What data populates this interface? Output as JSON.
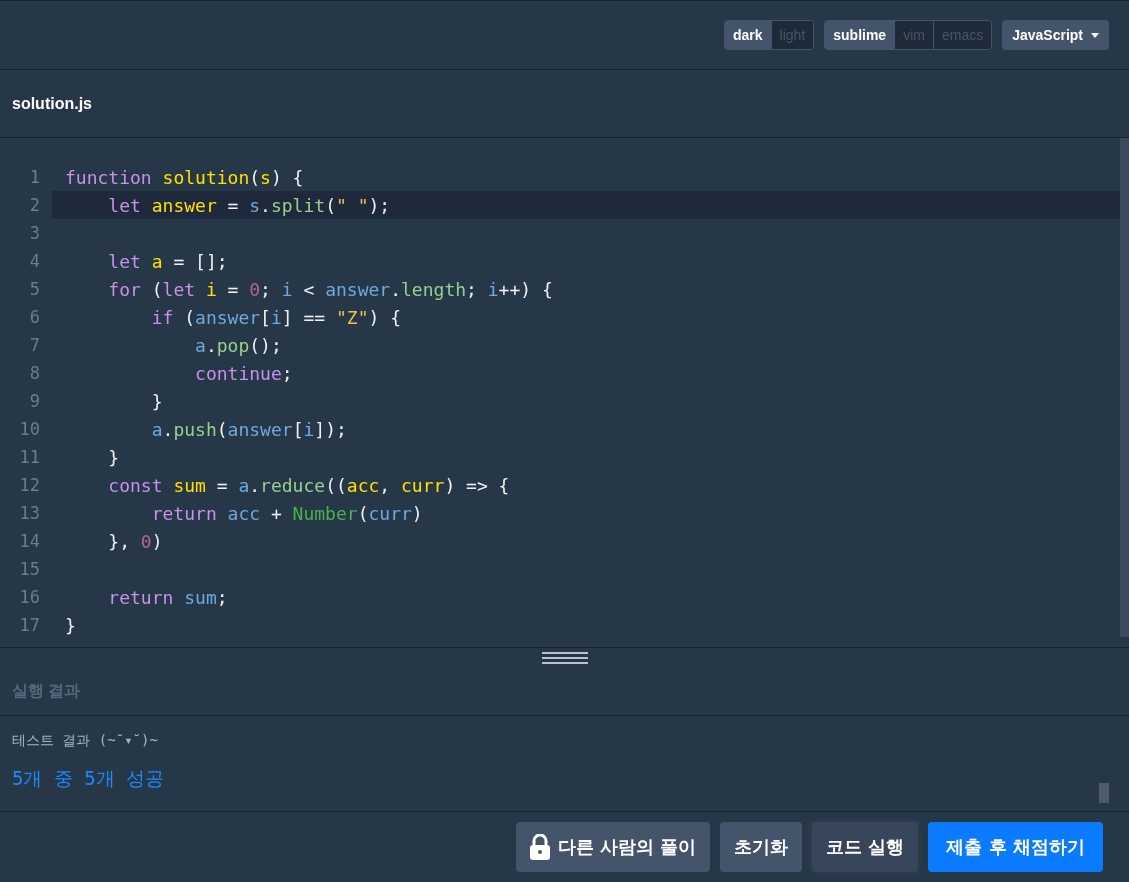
{
  "toolbar": {
    "theme_toggle": [
      {
        "label": "dark",
        "selected": true
      },
      {
        "label": "light",
        "selected": false
      }
    ],
    "keymap_toggle": [
      {
        "label": "sublime",
        "selected": true
      },
      {
        "label": "vim",
        "selected": false
      },
      {
        "label": "emacs",
        "selected": false
      }
    ],
    "language": "JavaScript"
  },
  "file_tab": "solution.js",
  "editor": {
    "lines": [
      {
        "number": "1",
        "active": false,
        "tokens": [
          {
            "text": "function ",
            "kind": "keyword"
          },
          {
            "text": "solution",
            "kind": "def"
          },
          {
            "text": "(",
            "kind": "plain"
          },
          {
            "text": "s",
            "kind": "def"
          },
          {
            "text": ") {",
            "kind": "plain"
          }
        ]
      },
      {
        "number": "2",
        "active": true,
        "tokens": [
          {
            "text": "    let ",
            "kind": "keyword"
          },
          {
            "text": "answer",
            "kind": "def"
          },
          {
            "text": " = ",
            "kind": "plain"
          },
          {
            "text": "s",
            "kind": "var"
          },
          {
            "text": ".",
            "kind": "plain"
          },
          {
            "text": "split",
            "kind": "prop"
          },
          {
            "text": "(",
            "kind": "plain"
          },
          {
            "text": "\" \"",
            "kind": "string"
          },
          {
            "text": ");",
            "kind": "plain"
          }
        ]
      },
      {
        "number": "3",
        "active": false
      },
      {
        "number": "4",
        "active": false,
        "tokens": [
          {
            "text": "    let ",
            "kind": "keyword"
          },
          {
            "text": "a",
            "kind": "def"
          },
          {
            "text": " = [];",
            "kind": "plain"
          }
        ]
      },
      {
        "number": "5",
        "active": false,
        "tokens": [
          {
            "text": "    for",
            "kind": "keyword"
          },
          {
            "text": " (",
            "kind": "plain"
          },
          {
            "text": "let ",
            "kind": "keyword"
          },
          {
            "text": "i",
            "kind": "def"
          },
          {
            "text": " = ",
            "kind": "plain"
          },
          {
            "text": "0",
            "kind": "number"
          },
          {
            "text": "; ",
            "kind": "plain"
          },
          {
            "text": "i",
            "kind": "var"
          },
          {
            "text": " < ",
            "kind": "plain"
          },
          {
            "text": "answer",
            "kind": "var"
          },
          {
            "text": ".",
            "kind": "plain"
          },
          {
            "text": "length",
            "kind": "prop"
          },
          {
            "text": "; ",
            "kind": "plain"
          },
          {
            "text": "i",
            "kind": "var"
          },
          {
            "text": "++) {",
            "kind": "plain"
          }
        ]
      },
      {
        "number": "6",
        "active": false,
        "tokens": [
          {
            "text": "        if",
            "kind": "keyword"
          },
          {
            "text": " (",
            "kind": "plain"
          },
          {
            "text": "answer",
            "kind": "var"
          },
          {
            "text": "[",
            "kind": "plain"
          },
          {
            "text": "i",
            "kind": "var"
          },
          {
            "text": "] == ",
            "kind": "plain"
          },
          {
            "text": "\"Z\"",
            "kind": "string"
          },
          {
            "text": ") {",
            "kind": "plain"
          }
        ]
      },
      {
        "number": "7",
        "active": false,
        "tokens": [
          {
            "text": "            a",
            "kind": "var"
          },
          {
            "text": ".",
            "kind": "plain"
          },
          {
            "text": "pop",
            "kind": "prop"
          },
          {
            "text": "();",
            "kind": "plain"
          }
        ]
      },
      {
        "number": "8",
        "active": false,
        "tokens": [
          {
            "text": "            continue",
            "kind": "keyword"
          },
          {
            "text": ";",
            "kind": "plain"
          }
        ]
      },
      {
        "number": "9",
        "active": false,
        "tokens": [
          {
            "text": "        }",
            "kind": "plain"
          }
        ]
      },
      {
        "number": "10",
        "active": false,
        "tokens": [
          {
            "text": "        a",
            "kind": "var"
          },
          {
            "text": ".",
            "kind": "plain"
          },
          {
            "text": "push",
            "kind": "prop"
          },
          {
            "text": "(",
            "kind": "plain"
          },
          {
            "text": "answer",
            "kind": "var"
          },
          {
            "text": "[",
            "kind": "plain"
          },
          {
            "text": "i",
            "kind": "var"
          },
          {
            "text": "]);",
            "kind": "plain"
          }
        ]
      },
      {
        "number": "11",
        "active": false,
        "tokens": [
          {
            "text": "    }",
            "kind": "plain"
          }
        ]
      },
      {
        "number": "12",
        "active": false,
        "tokens": [
          {
            "text": "    const ",
            "kind": "keyword"
          },
          {
            "text": "sum",
            "kind": "def"
          },
          {
            "text": " = ",
            "kind": "plain"
          },
          {
            "text": "a",
            "kind": "var"
          },
          {
            "text": ".",
            "kind": "plain"
          },
          {
            "text": "reduce",
            "kind": "prop"
          },
          {
            "text": "((",
            "kind": "plain"
          },
          {
            "text": "acc",
            "kind": "def"
          },
          {
            "text": ", ",
            "kind": "plain"
          },
          {
            "text": "curr",
            "kind": "def"
          },
          {
            "text": ") => {",
            "kind": "plain"
          }
        ]
      },
      {
        "number": "13",
        "active": false,
        "tokens": [
          {
            "text": "        return ",
            "kind": "keyword"
          },
          {
            "text": "acc",
            "kind": "var"
          },
          {
            "text": " + ",
            "kind": "plain"
          },
          {
            "text": "Number",
            "kind": "builtin"
          },
          {
            "text": "(",
            "kind": "plain"
          },
          {
            "text": "curr",
            "kind": "var"
          },
          {
            "text": ")",
            "kind": "plain"
          }
        ]
      },
      {
        "number": "14",
        "active": false,
        "tokens": [
          {
            "text": "    }, ",
            "kind": "plain"
          },
          {
            "text": "0",
            "kind": "number"
          },
          {
            "text": ")",
            "kind": "plain"
          }
        ]
      },
      {
        "number": "15",
        "active": false
      },
      {
        "number": "16",
        "active": false,
        "tokens": [
          {
            "text": "    return ",
            "kind": "keyword"
          },
          {
            "text": "sum",
            "kind": "var"
          },
          {
            "text": ";",
            "kind": "plain"
          }
        ]
      },
      {
        "number": "17",
        "active": false,
        "tokens": [
          {
            "text": "}",
            "kind": "plain"
          }
        ]
      }
    ]
  },
  "result": {
    "title": "실행 결과",
    "label": "테스트 결과 (~˘▾˘)~",
    "summary": "5개 중 5개 성공"
  },
  "buttons": [
    {
      "label": "다른 사람의 풀이",
      "kind": "locked"
    },
    {
      "label": "초기화",
      "kind": "secondary"
    },
    {
      "label": "코드 실행",
      "kind": "run"
    },
    {
      "label": "제출 후 채점하기",
      "kind": "primary"
    }
  ]
}
